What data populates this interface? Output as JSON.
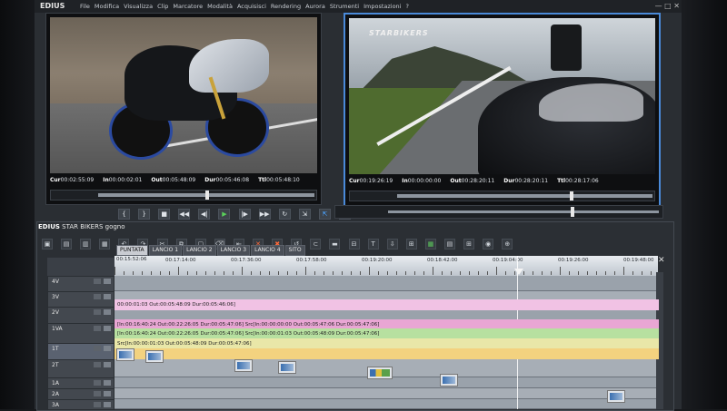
{
  "app": {
    "logo": "EDIUS",
    "menus": [
      "File",
      "Modifica",
      "Visualizza",
      "Clip",
      "Marcatore",
      "Modalità",
      "Acquisisci",
      "Rendering",
      "Aurora",
      "Strumenti",
      "Impostazioni",
      "?"
    ],
    "window_controls": "— □ ✕"
  },
  "player": {
    "timecodes": [
      {
        "label": "Cur",
        "value": "00:02:55:09"
      },
      {
        "label": "In",
        "value": "00:00:02:01"
      },
      {
        "label": "Out",
        "value": "00:05:48:09"
      },
      {
        "label": "Dur",
        "value": "00:05:46:08"
      },
      {
        "label": "Ttl",
        "value": "00:05:48:10"
      }
    ],
    "scrub_position": 0.5
  },
  "recorder": {
    "watermark": "STARBIKERS",
    "timecodes": [
      {
        "label": "Cur",
        "value": "00:19:26:19"
      },
      {
        "label": "In",
        "value": "00:00:00:00"
      },
      {
        "label": "Out",
        "value": "00:28:20:11"
      },
      {
        "label": "Dur",
        "value": "00:28:20:11"
      },
      {
        "label": "Ttl",
        "value": "00:28:17:06"
      }
    ],
    "scrub_position": 0.68
  },
  "timeline": {
    "title_logo": "EDIUS",
    "project_name": "STAR BIKERS gogno",
    "tabs": [
      "PUNTATA",
      "LANCIO 1",
      "LANCIO 2",
      "LANCIO 3",
      "LANCIO 4",
      "SITO"
    ],
    "active_tab": 0,
    "ruler_start": "00:15:52:06",
    "ruler_labels": [
      "00:17:14:00",
      "00:17:36:00",
      "00:17:58:00",
      "00:19:20:00",
      "00:18:42:00",
      "00:19:04:00",
      "00:19:26:00",
      "00:19:48:00"
    ],
    "tracks": [
      {
        "name": "4V"
      },
      {
        "name": "3V"
      },
      {
        "name": "2V"
      },
      {
        "name": "1VA"
      },
      {
        "name": "1T"
      },
      {
        "name": "2T"
      },
      {
        "name": "1A"
      },
      {
        "name": "2A"
      },
      {
        "name": "3A"
      }
    ],
    "clips": {
      "video_top": "00:00:01:03 Out:00:05:48:09 Dur:00:05:46:06]",
      "video_pink": "[In:00:16:40:24 Out:00:22:26:05 Dur:00:05:47:06]   Src[In:00:00:00:00 Out:00:05:47:06 Dur:00:05:47:06]",
      "audio_green": "[In:00:16:40:24 Out:00:22:26:05 Dur:00:05:47:06]  Src[In:00:00:01:03 Out:00:05:48:09 Dur:00:05:47:06]",
      "audio_yellow": "Src[In:00:00:01:03 Out:00:05:48:09 Dur:00:05:47:06]"
    }
  }
}
